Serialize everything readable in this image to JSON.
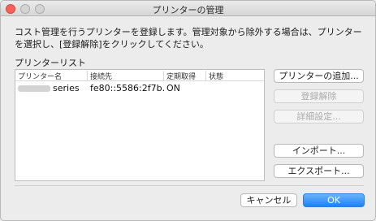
{
  "window": {
    "title": "プリンターの管理"
  },
  "description": "コスト管理を行うプリンターを登録します。管理対象から除外する場合は、プリンターを選択し、[登録解除]をクリックしてください。",
  "printer_list": {
    "label": "プリンターリスト",
    "columns": [
      "プリンター名",
      "接続先",
      "定期取得",
      "状態"
    ],
    "rows": [
      {
        "name": "series",
        "connection": "fe80::5586:2f7b...",
        "periodic": "ON",
        "status": ""
      }
    ]
  },
  "side_buttons": {
    "add": "プリンターの追加...",
    "unregister": "登録解除",
    "details": "詳細設定...",
    "import": "インポート...",
    "export": "エクスポート..."
  },
  "footer": {
    "cancel": "キャンセル",
    "ok": "OK"
  }
}
